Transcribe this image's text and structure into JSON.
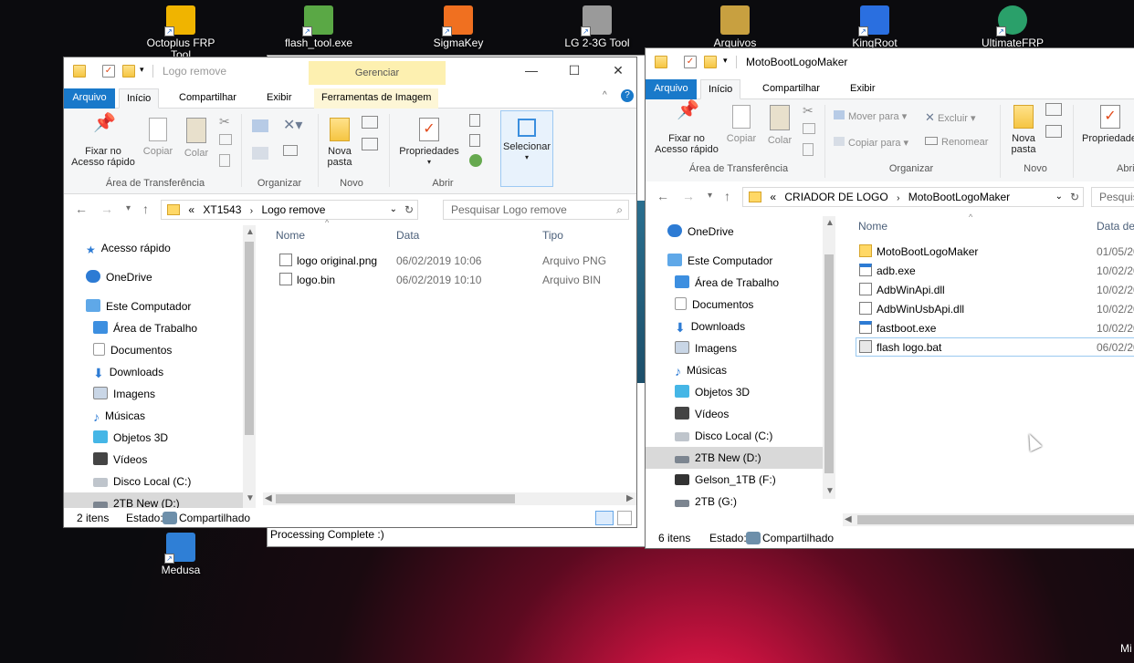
{
  "desktop": {
    "icons": [
      {
        "label": "Octoplus FRP Tool",
        "color": "#f0b400"
      },
      {
        "label": "flash_tool.exe",
        "color": "#5aa845"
      },
      {
        "label": "SigmaKey",
        "color": "#f07020"
      },
      {
        "label": "LG 2-3G Tool",
        "color": "#9a9a9a"
      },
      {
        "label": "Arquivos",
        "color": "#c8a040"
      },
      {
        "label": "KingRoot",
        "color": "#2a6fe0"
      },
      {
        "label": "UltimateFRP",
        "color": "#2aa06a"
      },
      {
        "label": "Medusa",
        "color": "#2f7fd6"
      }
    ],
    "background_text": "Processing Complete :)",
    "corner_text": "Mi"
  },
  "left_window": {
    "title": "Logo remove",
    "context_tab": "Gerenciar",
    "tabs": [
      "Arquivo",
      "Início",
      "Compartilhar",
      "Exibir",
      "Ferramentas de Imagem"
    ],
    "ribbon": {
      "pin": "Fixar no Acesso rápido",
      "copy": "Copiar",
      "paste": "Colar",
      "new_folder": "Nova pasta",
      "properties": "Propriedades",
      "select": "Selecionar",
      "groups": [
        "Área de Transferência",
        "Organizar",
        "Novo",
        "Abrir"
      ]
    },
    "address": {
      "overflow": "«",
      "parts": [
        "XT1543",
        "Logo remove"
      ]
    },
    "search_placeholder": "Pesquisar Logo remove",
    "nav": [
      "Acesso rápido",
      "OneDrive",
      "Este Computador",
      "Área de Trabalho",
      "Documentos",
      "Downloads",
      "Imagens",
      "Músicas",
      "Objetos 3D",
      "Vídeos",
      "Disco Local (C:)",
      "2TB New (D:)"
    ],
    "columns": [
      "Nome",
      "Data",
      "Tipo"
    ],
    "files": [
      {
        "name": "logo original.png",
        "date": "06/02/2019 10:06",
        "type": "Arquivo PNG"
      },
      {
        "name": "logo.bin",
        "date": "06/02/2019 10:10",
        "type": "Arquivo BIN"
      }
    ],
    "status": {
      "count": "2 itens",
      "state_label": "Estado:",
      "state": "Compartilhado"
    }
  },
  "right_window": {
    "title": "MotoBootLogoMaker",
    "tabs": [
      "Arquivo",
      "Início",
      "Compartilhar",
      "Exibir"
    ],
    "ribbon": {
      "pin": "Fixar no Acesso rápido",
      "copy": "Copiar",
      "paste": "Colar",
      "move_to": "Mover para",
      "copy_to": "Copiar para",
      "delete": "Excluir",
      "rename": "Renomear",
      "new_folder": "Nova pasta",
      "properties": "Propriedades",
      "groups": [
        "Área de Transferência",
        "Organizar",
        "Novo",
        "Abri"
      ]
    },
    "address": {
      "overflow": "«",
      "parts": [
        "CRIADOR DE LOGO",
        "MotoBootLogoMaker"
      ]
    },
    "search_placeholder": "Pesquis",
    "nav": [
      "OneDrive",
      "Este Computador",
      "Área de Trabalho",
      "Documentos",
      "Downloads",
      "Imagens",
      "Músicas",
      "Objetos 3D",
      "Vídeos",
      "Disco Local (C:)",
      "2TB New (D:)",
      "Gelson_1TB (F:)",
      "2TB (G:)"
    ],
    "columns": [
      "Nome",
      "Data de"
    ],
    "files": [
      {
        "name": "MotoBootLogoMaker",
        "date": "01/05/20"
      },
      {
        "name": "adb.exe",
        "date": "10/02/20"
      },
      {
        "name": "AdbWinApi.dll",
        "date": "10/02/20"
      },
      {
        "name": "AdbWinUsbApi.dll",
        "date": "10/02/20"
      },
      {
        "name": "fastboot.exe",
        "date": "10/02/20"
      },
      {
        "name": "flash logo.bat",
        "date": "06/02/20"
      }
    ],
    "status": {
      "count": "6 itens",
      "state_label": "Estado:",
      "state": "Compartilhado"
    }
  }
}
